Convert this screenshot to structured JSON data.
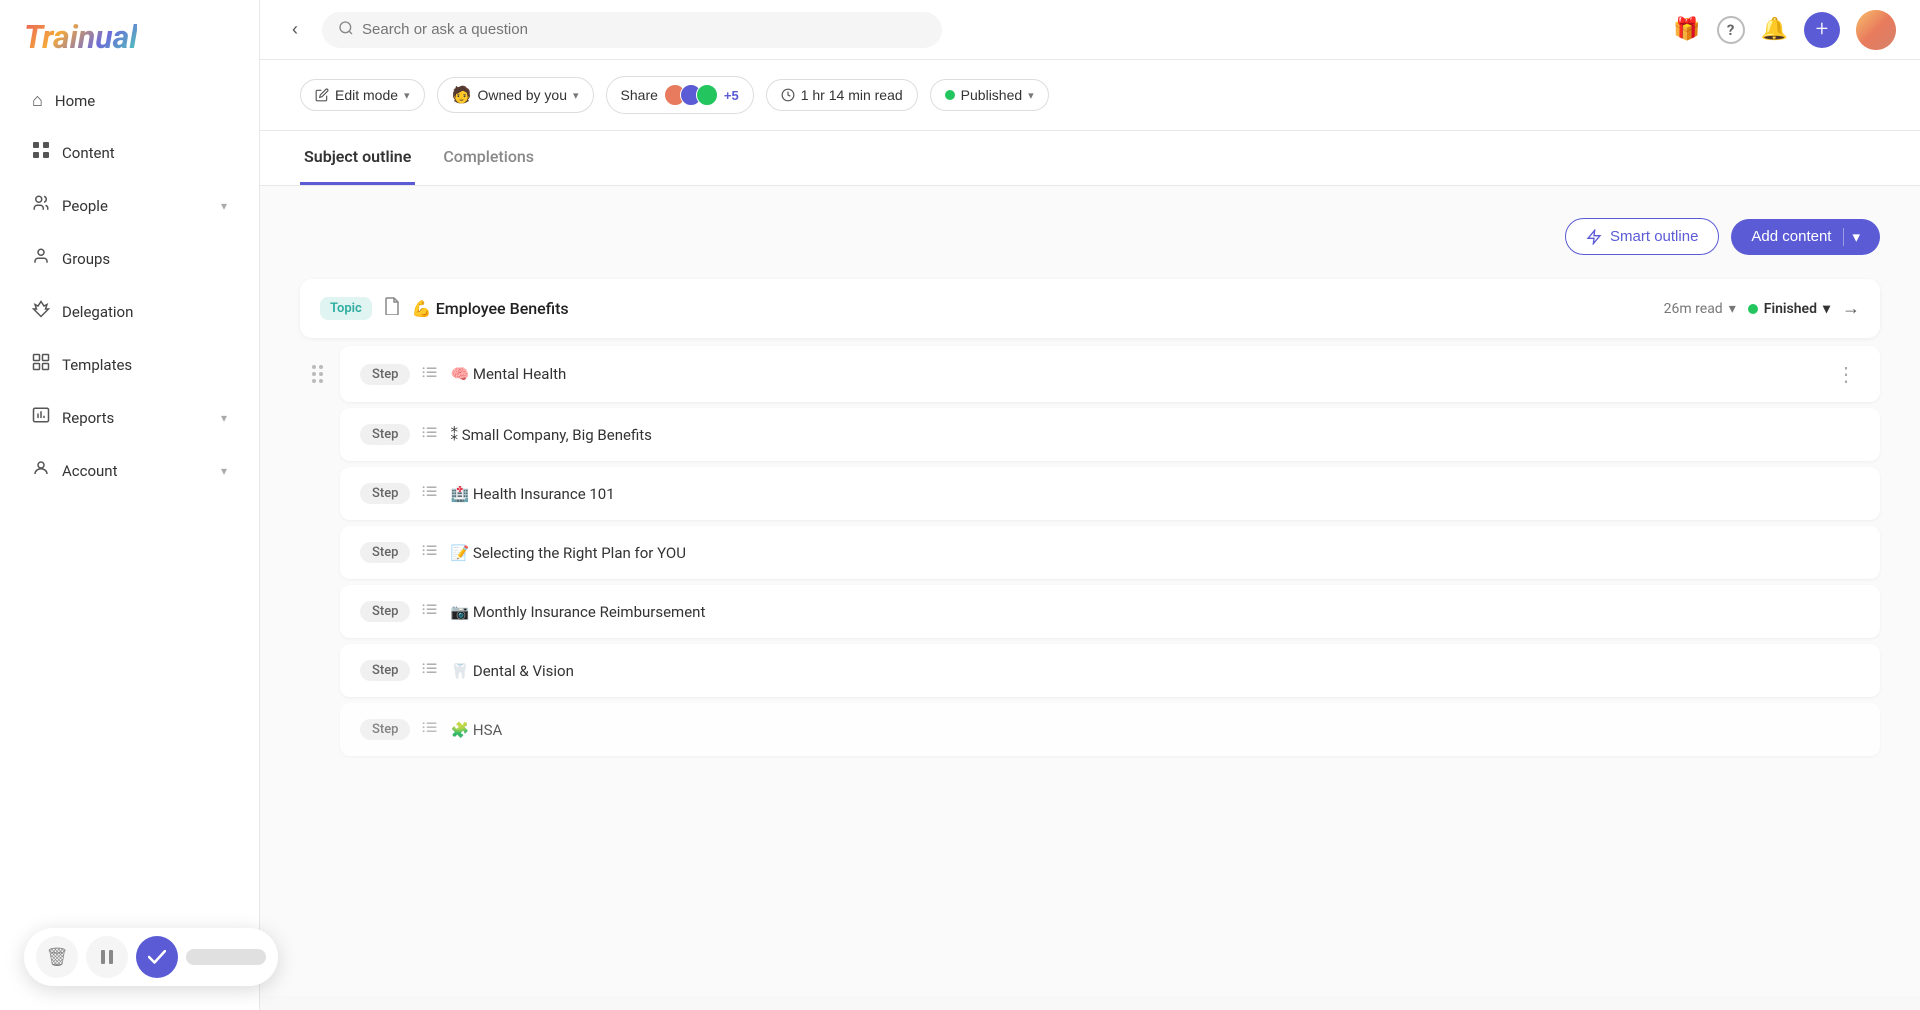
{
  "logo": "Trainual",
  "search": {
    "placeholder": "Search or ask a question"
  },
  "nav": {
    "collapse_icon": "‹",
    "items": [
      {
        "id": "home",
        "label": "Home",
        "icon": "⌂",
        "has_chevron": false
      },
      {
        "id": "content",
        "label": "Content",
        "icon": "▦",
        "has_chevron": false
      },
      {
        "id": "people",
        "label": "People",
        "icon": "👤",
        "has_chevron": true
      },
      {
        "id": "groups",
        "label": "Groups",
        "icon": "👥",
        "has_chevron": false
      },
      {
        "id": "delegation",
        "label": "Delegation",
        "icon": "◈",
        "has_chevron": false
      },
      {
        "id": "templates",
        "label": "Templates",
        "icon": "⊞",
        "has_chevron": false
      },
      {
        "id": "reports",
        "label": "Reports",
        "icon": "📊",
        "has_chevron": true
      },
      {
        "id": "account",
        "label": "Account",
        "icon": "👤",
        "has_chevron": true
      }
    ]
  },
  "topbar_icons": {
    "gift": "🎁",
    "help": "?",
    "bell": "🔔",
    "plus": "+"
  },
  "action_bar": {
    "edit_mode": "Edit mode",
    "owned_by": "Owned by you",
    "share": "Share",
    "share_count": "+5",
    "read_time": "1 hr 14 min read",
    "status": "Published",
    "status_color": "#22c55e"
  },
  "tabs": [
    {
      "id": "subject-outline",
      "label": "Subject outline",
      "active": true
    },
    {
      "id": "completions",
      "label": "Completions",
      "active": false
    }
  ],
  "outline": {
    "smart_outline_label": "Smart outline",
    "add_content_label": "Add content",
    "topic": {
      "badge": "Topic",
      "icon": "📄",
      "title": "💪 Employee Benefits",
      "read_time": "26m read",
      "status": "Finished",
      "status_color": "#22c55e"
    },
    "steps": [
      {
        "id": 1,
        "label": "Step",
        "icon": "≡",
        "title": "🧠 Mental Health",
        "has_drag": true
      },
      {
        "id": 2,
        "label": "Step",
        "icon": "≡",
        "title": "⁑ Small Company, Big Benefits",
        "has_drag": false
      },
      {
        "id": 3,
        "label": "Step",
        "icon": "≡",
        "title": "🏥 Health Insurance 101",
        "has_drag": false
      },
      {
        "id": 4,
        "label": "Step",
        "icon": "≡",
        "title": "📝 Selecting the Right Plan for YOU",
        "has_drag": false
      },
      {
        "id": 5,
        "label": "Step",
        "icon": "≡",
        "title": "📷 Monthly Insurance Reimbursement",
        "has_drag": false
      },
      {
        "id": 6,
        "label": "Step",
        "icon": "≡",
        "title": "🦷 Dental & Vision",
        "has_drag": false
      },
      {
        "id": 7,
        "label": "Step",
        "icon": "≡",
        "title": "🧩 HSA",
        "has_drag": false,
        "partial": true
      }
    ]
  },
  "toolbar": {
    "delete_icon": "🗑",
    "pause_icon": "⏸",
    "check_icon": "✓",
    "label": ""
  }
}
